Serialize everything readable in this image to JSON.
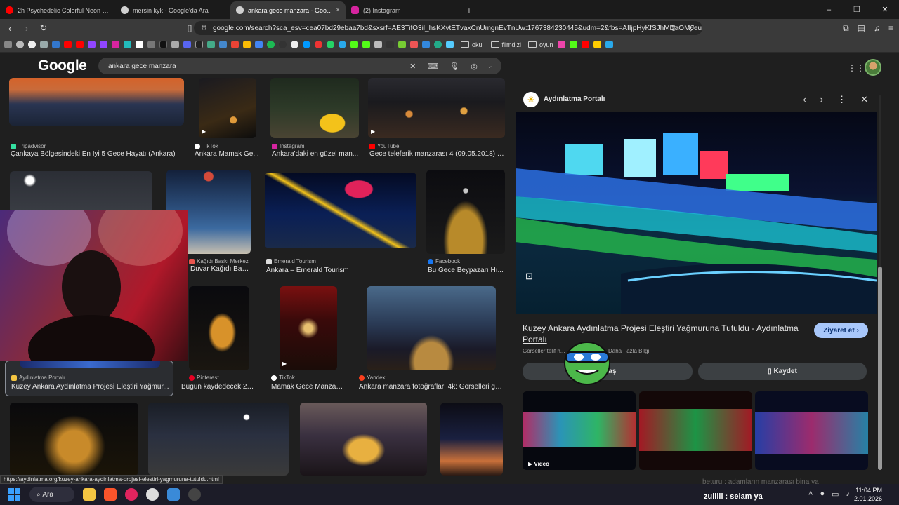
{
  "browser": {
    "tabs": [
      {
        "label": "2h Psychedelic Colorful Neon Backgr",
        "favicon": "youtube-icon",
        "color": "#ff0000",
        "active": false
      },
      {
        "label": "mersin kyk - Google'da Ara",
        "favicon": "google-icon",
        "color": "#cccccc",
        "active": false
      },
      {
        "label": "ankara gece manzara - Google'da",
        "favicon": "google-icon",
        "color": "#cccccc",
        "active": true
      },
      {
        "label": "(2) Instagram",
        "favicon": "instagram-icon",
        "color": "#d6249f",
        "active": false
      }
    ],
    "close_tab_glyph": "×",
    "new_tab_glyph": "+",
    "window_controls": {
      "minimize": "–",
      "maximize": "❐",
      "close": "✕"
    },
    "url": "google.com/search?sca_esv=cea07bd29ebaa7bd&sxsrf=AE3TifO3il_hsKXvtETvaxCnUmgnEvTnUw:1767384230445&udm=2&fbs=AIIjpHyKfSJhMDaOM6euS...",
    "bookmark_folders": [
      "okul",
      "filmdizi",
      "oyun"
    ]
  },
  "google": {
    "logo": "Google",
    "query": "ankara gece manzara"
  },
  "results": [
    {
      "source": "Tripadvisor",
      "title": "Çankaya Bölgesindeki En İyi 5 Gece Hayatı (Ankara)",
      "icon_color": "#34e0a1"
    },
    {
      "source": "TikTok",
      "title": "Ankara Mamak Ge...",
      "icon_color": "#ffffff"
    },
    {
      "source": "Instagram",
      "title": "Ankara'daki en güzel man...",
      "icon_color": "#d6249f"
    },
    {
      "source": "YouTube",
      "title": "Gece teleferik manzarası 4 (09.05.2018) -...",
      "icon_color": "#ff0000"
    },
    {
      "source": "Kağıdı Baskı Merkezi",
      "title": "Duvar Kağıdı Bas...",
      "icon_color": "#e8554e"
    },
    {
      "source": "Emerald Tourism",
      "title": "Ankara – Emerald Tourism",
      "icon_color": "#dddddd"
    },
    {
      "source": "Facebook",
      "title": "Bu Gece Beypazarı Hı...",
      "icon_color": "#1877f2"
    },
    {
      "source": "Aydınlatma Portalı",
      "title": "Kuzey Ankara Aydınlatma Projesi Eleştiri Yağmur...",
      "icon_color": "#f4c542"
    },
    {
      "source": "Pinterest",
      "title": "Bugün kaydedecek 22 ...",
      "icon_color": "#e60023"
    },
    {
      "source": "TikTok",
      "title": "Mamak Gece Manzara...",
      "icon_color": "#ffffff"
    },
    {
      "source": "Yandex",
      "title": "Ankara manzara fotoğrafları 4k: Görselleri gör...",
      "icon_color": "#fc3f1d"
    }
  ],
  "panel": {
    "site": "Aydınlatma Portalı",
    "headline": "Kuzey Ankara Aydınlatma Projesi Eleştiri Yağmuruna Tutuldu - Aydınlatma Portalı",
    "visit_label": "Ziyaret et",
    "copyright_label": "Görseller telif h...",
    "more_info": "Daha Fazla Bilgi",
    "share_label": "aylaş",
    "save_label": "Kaydet",
    "video_label": "Video"
  },
  "status_url": "https://aydinlatma.org/kuzey-ankara-aydinlatma-projesi-elestiri-yagmuruna-tutuldu.html",
  "chat_overlay": "beturu : adamların manzarası bina ya",
  "taskbar": {
    "search_label": "Ara",
    "chat_message": "zulliii : selam ya",
    "time": "11:04 PM",
    "date": "2.01.2026"
  }
}
